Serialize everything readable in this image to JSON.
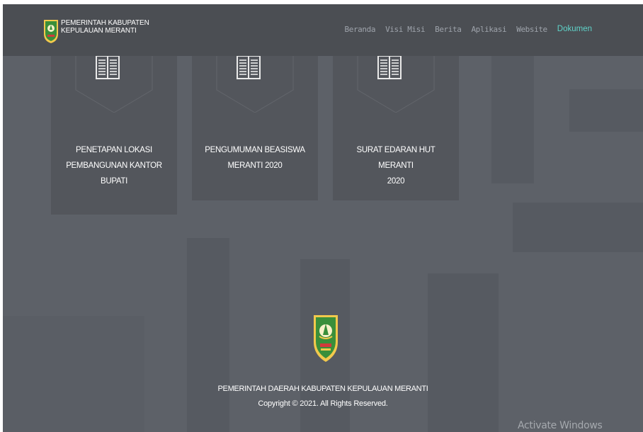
{
  "header": {
    "logo_text_line1": "PEMERINTAH KABUPATEN",
    "logo_text_line2": "KEPULAUAN MERANTI"
  },
  "nav": {
    "items": [
      {
        "label": "Beranda",
        "active": false
      },
      {
        "label": "Visi Misi",
        "active": false
      },
      {
        "label": "Berita",
        "active": false
      },
      {
        "label": "Aplikasi",
        "active": false
      },
      {
        "label": "Website",
        "active": false
      },
      {
        "label": "Dokumen",
        "active": true
      }
    ],
    "active_color": "#5fd3c9"
  },
  "cards": [
    {
      "title_lines": [
        "PENETAPAN LOKASI",
        "PEMBANGUNAN KANTOR",
        "BUPATI"
      ],
      "icon": "document-icon"
    },
    {
      "title_lines": [
        "PENGUMUMAN BEASISWA",
        "MERANTI 2020"
      ],
      "icon": "document-icon"
    },
    {
      "title_lines": [
        "SURAT EDARAN HUT MERANTI",
        "2020"
      ],
      "icon": "document-icon"
    }
  ],
  "footer": {
    "name": "PEMERINTAH DAERAH KABUPATEN KEPULAUAN MERANTI",
    "copyright": "Copyright © 2021. All Rights Reserved."
  },
  "watermark": "Activate Windows"
}
